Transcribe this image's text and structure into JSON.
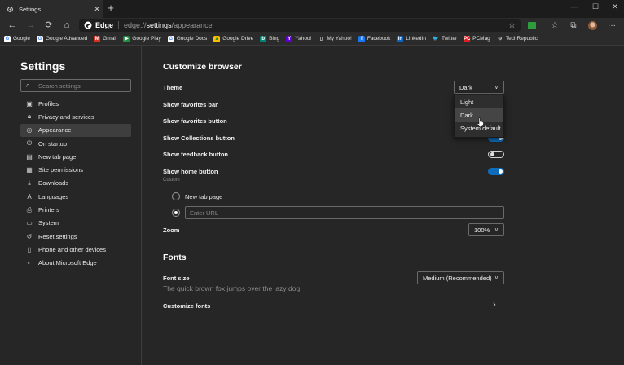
{
  "tab": {
    "title": "Settings",
    "close": "✕",
    "new_tab": "+"
  },
  "window": {
    "minimize": "—",
    "maximize": "☐",
    "close": "✕"
  },
  "toolbar": {
    "back": "←",
    "forward": "→",
    "refresh": "⟳",
    "home": "⌂",
    "brand": "Edge",
    "url_prefix": "edge://",
    "url_host": "settings",
    "url_path": "/appearance",
    "favorite_star": "☆",
    "extension_badge": "",
    "favorites": "☆",
    "collections": "⧉",
    "more": "···"
  },
  "favorites_bar": [
    {
      "label": "Google",
      "icon": "google-icon",
      "color": "#ffffff",
      "glyph": "G",
      "fg": "#4285f4"
    },
    {
      "label": "Google Advanced",
      "icon": "google-icon",
      "color": "#ffffff",
      "glyph": "G",
      "fg": "#4285f4"
    },
    {
      "label": "Gmail",
      "icon": "gmail-icon",
      "color": "#d93025",
      "glyph": "M",
      "fg": "#ffffff"
    },
    {
      "label": "Google Play",
      "icon": "play-icon",
      "color": "#1e8e3e",
      "glyph": "▶",
      "fg": "#ffffff"
    },
    {
      "label": "Google Docs",
      "icon": "google-icon",
      "color": "#ffffff",
      "glyph": "G",
      "fg": "#4285f4"
    },
    {
      "label": "Google Drive",
      "icon": "drive-icon",
      "color": "#fbbc04",
      "glyph": "▲",
      "fg": "#1e8e3e"
    },
    {
      "label": "Bing",
      "icon": "bing-icon",
      "color": "#008373",
      "glyph": "b",
      "fg": "#ffffff"
    },
    {
      "label": "Yahoo!",
      "icon": "yahoo-icon",
      "color": "#6001d2",
      "glyph": "Y",
      "fg": "#ffffff"
    },
    {
      "label": "My Yahoo!",
      "icon": "page-icon",
      "color": "#2b2b2b",
      "glyph": "▯",
      "fg": "#d0d0d0"
    },
    {
      "label": "Facebook",
      "icon": "facebook-icon",
      "color": "#1877f2",
      "glyph": "f",
      "fg": "#ffffff"
    },
    {
      "label": "LinkedIn",
      "icon": "linkedin-icon",
      "color": "#0a66c2",
      "glyph": "in",
      "fg": "#ffffff"
    },
    {
      "label": "Twitter",
      "icon": "twitter-icon",
      "color": "#2b2b2b",
      "glyph": "🐦",
      "fg": "#1d9bf0"
    },
    {
      "label": "PCMag",
      "icon": "pcmag-icon",
      "color": "#e02020",
      "glyph": "PC",
      "fg": "#ffffff"
    },
    {
      "label": "TechRepublic",
      "icon": "techrepublic-icon",
      "color": "#2b2b2b",
      "glyph": "⊖",
      "fg": "#d0d0d0"
    }
  ],
  "sidebar": {
    "title": "Settings",
    "search_placeholder": "Search settings",
    "items": [
      {
        "label": "Profiles",
        "icon": "profile-icon",
        "glyph": "▣",
        "active": false
      },
      {
        "label": "Privacy and services",
        "icon": "lock-icon",
        "glyph": "🔒︎",
        "active": false
      },
      {
        "label": "Appearance",
        "icon": "palette-icon",
        "glyph": "◎",
        "active": true
      },
      {
        "label": "On startup",
        "icon": "power-icon",
        "glyph": "⏻",
        "active": false
      },
      {
        "label": "New tab page",
        "icon": "newtab-icon",
        "glyph": "▤",
        "active": false
      },
      {
        "label": "Site permissions",
        "icon": "permissions-icon",
        "glyph": "▦",
        "active": false
      },
      {
        "label": "Downloads",
        "icon": "download-icon",
        "glyph": "⤓",
        "active": false
      },
      {
        "label": "Languages",
        "icon": "language-icon",
        "glyph": "A",
        "active": false
      },
      {
        "label": "Printers",
        "icon": "printer-icon",
        "glyph": "⎙",
        "active": false
      },
      {
        "label": "System",
        "icon": "system-icon",
        "glyph": "▭",
        "active": false
      },
      {
        "label": "Reset settings",
        "icon": "reset-icon",
        "glyph": "↺",
        "active": false
      },
      {
        "label": "Phone and other devices",
        "icon": "phone-icon",
        "glyph": "▯",
        "active": false
      },
      {
        "label": "About Microsoft Edge",
        "icon": "edge-icon",
        "glyph": "◐",
        "active": false
      }
    ]
  },
  "customize": {
    "heading": "Customize browser",
    "theme_label": "Theme",
    "theme_value": "Dark",
    "theme_options": [
      "Light",
      "Dark",
      "System default"
    ],
    "show_favorites_bar": "Show favorites bar",
    "show_favorites_button": "Show favorites button",
    "show_collections_button": "Show Collections button",
    "show_feedback_button": "Show feedback button",
    "show_home_button": "Show home button",
    "home_sub": "Custom",
    "radio_new_tab": "New tab page",
    "url_placeholder": "Enter URL",
    "zoom_label": "Zoom",
    "zoom_value": "100%"
  },
  "toggles": {
    "collections": true,
    "feedback": false,
    "home": true
  },
  "fonts": {
    "heading": "Fonts",
    "font_size_label": "Font size",
    "font_size_value": "Medium (Recommended)",
    "preview": "The quick brown fox jumps over the lazy dog",
    "customize_fonts": "Customize fonts"
  },
  "colors": {
    "accent": "#0f6cbd",
    "background": "#262626"
  }
}
